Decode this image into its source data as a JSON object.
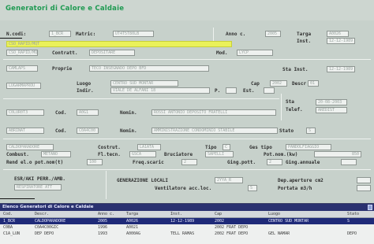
{
  "app": {
    "title": "Generatori di Calore e Caldaie"
  },
  "form": {
    "codice": {
      "label": "N.codi:",
      "value": "1_BCR"
    },
    "matricola": {
      "label": "Matric:",
      "value": "UT4T5T80LB"
    },
    "anno": {
      "label": "Anno c.",
      "value": "2005"
    },
    "targa": {
      "label": "Targa",
      "value": "A0026"
    },
    "inst": {
      "label": "Inst.",
      "value": "12-12-1989"
    },
    "contratto": {
      "label": "Contratt.",
      "value": "DEPOSITARE"
    },
    "contratto_code": {
      "value": "CSO_RAPID/MQT"
    },
    "mod": {
      "label": "Mod.",
      "value": "LYCP"
    },
    "indirizzo_code": {
      "value": "CAMLAPS"
    },
    "proprieta": {
      "label": "Proprie",
      "value": "TECO INSEGNADO DEPO BFD"
    },
    "sta_inst": {
      "label": "Sta Inst.",
      "value": "12-12-1989"
    },
    "luogo_code": {
      "value": "LUGARMAPROU"
    },
    "luogo": {
      "label": "Luogo",
      "value": "CENTRO SUD MONTAR"
    },
    "cap": {
      "label": "Cap",
      "value": "2002"
    },
    "descr": {
      "label": "Descr",
      "value": "01"
    },
    "indir": {
      "label": "Indir.",
      "value": "VIALE DE ALFANI 18"
    },
    "p": {
      "label": "P.",
      "value": ""
    },
    "est": {
      "label": "Est.",
      "value": ""
    },
    "sta": {
      "label": "Sta",
      "value": "20-08-2003"
    },
    "telef": {
      "label": "Telef.",
      "value": "AREDIST"
    },
    "cliente_code": {
      "value": "C0LUR0T3"
    },
    "cod1": {
      "label": "Cod.",
      "value": "A0G1"
    },
    "nomin1": {
      "label": "Nomin.",
      "value": "ROSSI ANTONIO DEPOSITO FRATELLI"
    },
    "amm_code": {
      "value": "ABRINAT"
    },
    "cod2": {
      "label": "Cod.",
      "value": "C0A4C00"
    },
    "nomin2": {
      "label": "Nomin.",
      "value": "AMMINISTRAZIONE CONDOMINIO STABILE"
    },
    "stato": {
      "label": "Stato",
      "value": "S"
    },
    "generazione_code": {
      "value": "CALDOPARADORE"
    },
    "costrut": {
      "label": "Costrut.",
      "value": "LA1ATA"
    },
    "tipo": {
      "label": "Tipo",
      "value": "C"
    },
    "ges_tipo": {
      "label": "Ges tipo",
      "value": "PANDOLFIAGGIO"
    },
    "combust": {
      "label": "Combust.",
      "value": "METANO"
    },
    "fl_tecn": {
      "label": "Fl.tecn.",
      "value": "GSCA"
    },
    "bruciatore": {
      "label": "Bruciatore",
      "value": "SAPELLI"
    },
    "pot_nom": {
      "label": "Pot.nom.(kw)",
      "value": "850"
    },
    "rend": {
      "label": "Rend el.o pot.nom(t)",
      "value": "100"
    },
    "freq_scaric": {
      "label": "Freq.scaric",
      "value": "2"
    },
    "ging_pott": {
      "label": "Ging.pott.",
      "value": "2"
    },
    "ging_annuale": {
      "label": "Ging.annuale",
      "value": ""
    },
    "esito": {
      "label": "ESR/AKI PERR./AMB.",
      "value": "RESPIRATORE ATT"
    },
    "generazione": {
      "label": "GENERAZIONE LOCALI",
      "value": "2YYA_R"
    },
    "dep_aperture": {
      "label": "Dep.aperture cm2",
      "value": ""
    },
    "ventilatore": {
      "label": "Ventilatore acc.loc.",
      "value": "S"
    },
    "portata": {
      "label": "Portata m3/h",
      "value": ""
    }
  },
  "grid": {
    "title": "Elenco Generatori di Calore e Caldaie",
    "columns": [
      "Cod.",
      "Descr.",
      "Anno c.",
      "Targa",
      "Inst.",
      "Cap",
      "Luogo",
      "Stato"
    ],
    "rows": [
      [
        "1_BCR",
        "CALDOPARADORE",
        "2005",
        "A0026",
        "12-12-1989",
        "2002",
        "CENTRO SUD MONTAR",
        "S"
      ],
      [
        "C0BA",
        "C0A4C00GIC",
        "1996",
        "A0021",
        "",
        "2002 FRAT DEPO",
        "",
        ""
      ],
      [
        "C1A_LUN",
        "DEP DEPO",
        "1993",
        "A000AG",
        "TELL RAMAS",
        "2002 FRAT DEPO",
        "GEL NAMAR",
        "DEPO"
      ]
    ]
  }
}
